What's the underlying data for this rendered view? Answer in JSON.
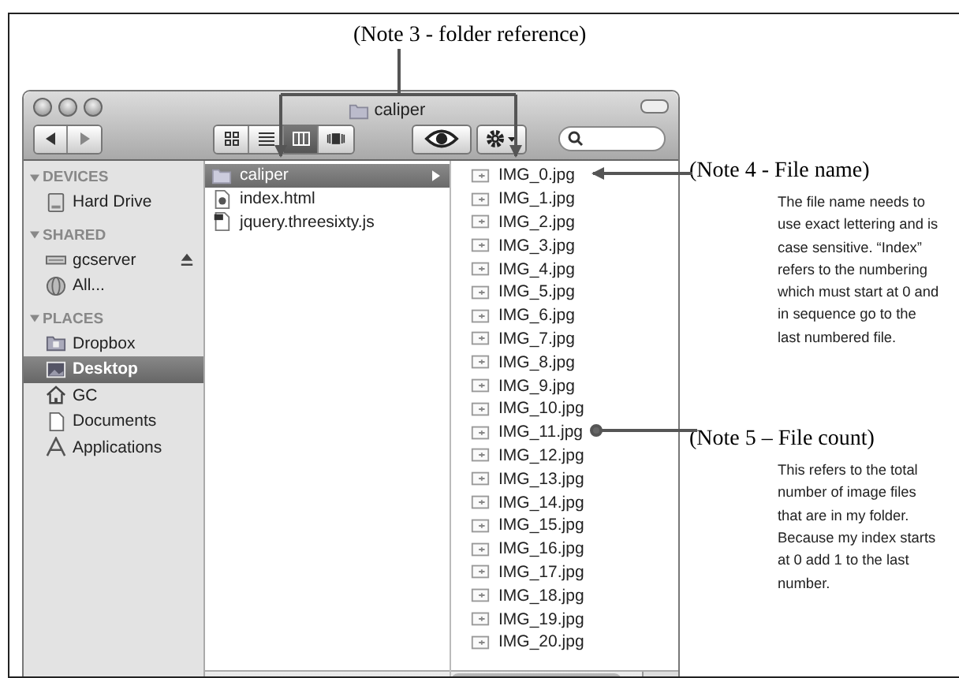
{
  "note_3": {
    "title": "(Note 3 - folder reference)"
  },
  "window": {
    "title": "caliper"
  },
  "toolbar": {
    "view_modes": [
      {
        "kind": "icons",
        "selected": false
      },
      {
        "kind": "list",
        "selected": false
      },
      {
        "kind": "columns",
        "selected": true
      },
      {
        "kind": "coverflow",
        "selected": false
      }
    ]
  },
  "sidebar": {
    "sections": [
      {
        "label": "DEVICES",
        "expanded": true,
        "items": [
          {
            "label": "Hard Drive",
            "kind": "drive",
            "selected": false,
            "ejectable": false
          }
        ]
      },
      {
        "label": "SHARED",
        "expanded": true,
        "items": [
          {
            "label": "gcserver",
            "kind": "server",
            "selected": false,
            "ejectable": true
          },
          {
            "label": "All...",
            "kind": "network",
            "selected": false,
            "ejectable": false
          }
        ]
      },
      {
        "label": "PLACES",
        "expanded": true,
        "items": [
          {
            "label": "Dropbox",
            "kind": "folder",
            "selected": false,
            "ejectable": false
          },
          {
            "label": "Desktop",
            "kind": "desktop",
            "selected": true,
            "ejectable": false
          },
          {
            "label": "GC",
            "kind": "home",
            "selected": false,
            "ejectable": false
          },
          {
            "label": "Documents",
            "kind": "document",
            "selected": false,
            "ejectable": false
          },
          {
            "label": "Applications",
            "kind": "apps",
            "selected": false,
            "ejectable": false
          }
        ]
      }
    ]
  },
  "columns": [
    {
      "items": [
        {
          "name": "caliper",
          "kind": "folder",
          "selected": true
        },
        {
          "name": "index.html",
          "kind": "html",
          "selected": false
        },
        {
          "name": "jquery.threesixty.js",
          "kind": "script",
          "selected": false
        }
      ]
    },
    {
      "items": [
        {
          "name": "IMG_0.jpg",
          "kind": "image",
          "selected": false
        },
        {
          "name": "IMG_1.jpg",
          "kind": "image",
          "selected": false
        },
        {
          "name": "IMG_2.jpg",
          "kind": "image",
          "selected": false
        },
        {
          "name": "IMG_3.jpg",
          "kind": "image",
          "selected": false
        },
        {
          "name": "IMG_4.jpg",
          "kind": "image",
          "selected": false
        },
        {
          "name": "IMG_5.jpg",
          "kind": "image",
          "selected": false
        },
        {
          "name": "IMG_6.jpg",
          "kind": "image",
          "selected": false
        },
        {
          "name": "IMG_7.jpg",
          "kind": "image",
          "selected": false
        },
        {
          "name": "IMG_8.jpg",
          "kind": "image",
          "selected": false
        },
        {
          "name": "IMG_9.jpg",
          "kind": "image",
          "selected": false
        },
        {
          "name": "IMG_10.jpg",
          "kind": "image",
          "selected": false
        },
        {
          "name": "IMG_11.jpg",
          "kind": "image",
          "selected": false
        },
        {
          "name": "IMG_12.jpg",
          "kind": "image",
          "selected": false
        },
        {
          "name": "IMG_13.jpg",
          "kind": "image",
          "selected": false
        },
        {
          "name": "IMG_14.jpg",
          "kind": "image",
          "selected": false
        },
        {
          "name": "IMG_15.jpg",
          "kind": "image",
          "selected": false
        },
        {
          "name": "IMG_16.jpg",
          "kind": "image",
          "selected": false
        },
        {
          "name": "IMG_17.jpg",
          "kind": "image",
          "selected": false
        },
        {
          "name": "IMG_18.jpg",
          "kind": "image",
          "selected": false
        },
        {
          "name": "IMG_19.jpg",
          "kind": "image",
          "selected": false
        },
        {
          "name": "IMG_20.jpg",
          "kind": "image",
          "selected": false
        }
      ]
    }
  ],
  "note_4": {
    "title": "(Note 4 - File name)",
    "body": "The file name needs to use exact lettering and is case sensitive. “Index” refers to the numbering which must start at 0 and in sequence go to the last numbered file."
  },
  "note_5": {
    "title": "(Note 5 – File count)",
    "body": "This refers to the total number of image files that are in my folder. Because my index starts at 0 add 1 to the last number."
  }
}
